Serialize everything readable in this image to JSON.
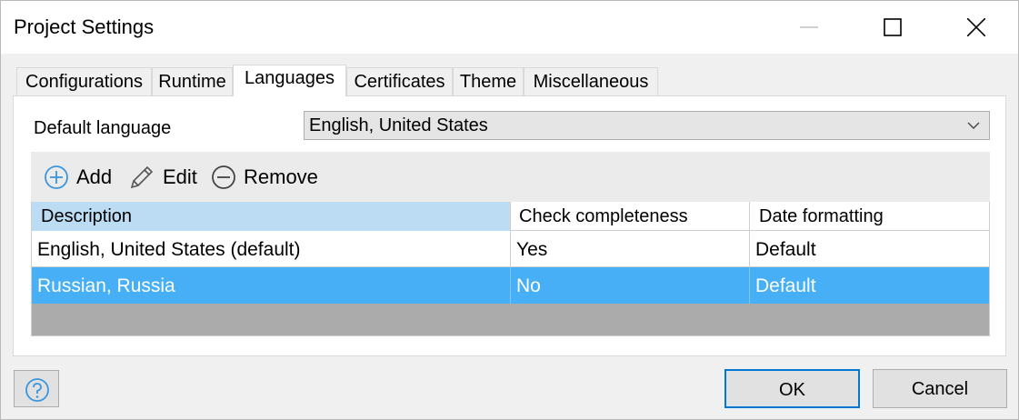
{
  "window": {
    "title": "Project Settings"
  },
  "tabs": [
    {
      "label": "Configurations"
    },
    {
      "label": "Runtime"
    },
    {
      "label": "Languages"
    },
    {
      "label": "Certificates"
    },
    {
      "label": "Theme"
    },
    {
      "label": "Miscellaneous"
    }
  ],
  "active_tab": "Languages",
  "languages": {
    "default_language_label": "Default language",
    "default_language_value": "English, United States",
    "toolbar": {
      "add_label": "Add",
      "edit_label": "Edit",
      "remove_label": "Remove"
    },
    "table": {
      "columns": [
        "Description",
        "Check completeness",
        "Date formatting"
      ],
      "rows": [
        [
          "English, United States (default)",
          "Yes",
          "Default"
        ],
        [
          "Russian, Russia",
          "No",
          "Default"
        ]
      ],
      "selected_row": 1
    }
  },
  "footer": {
    "ok_label": "OK",
    "cancel_label": "Cancel"
  },
  "colors": {
    "selection": "#47aff5",
    "sorted_header": "#bcdcf4",
    "accent": "#0078d7"
  },
  "icons": [
    "minimize-icon",
    "maximize-icon",
    "close-icon",
    "chevron-down-icon",
    "add-circle-icon",
    "pencil-icon",
    "remove-circle-icon",
    "help-icon"
  ]
}
